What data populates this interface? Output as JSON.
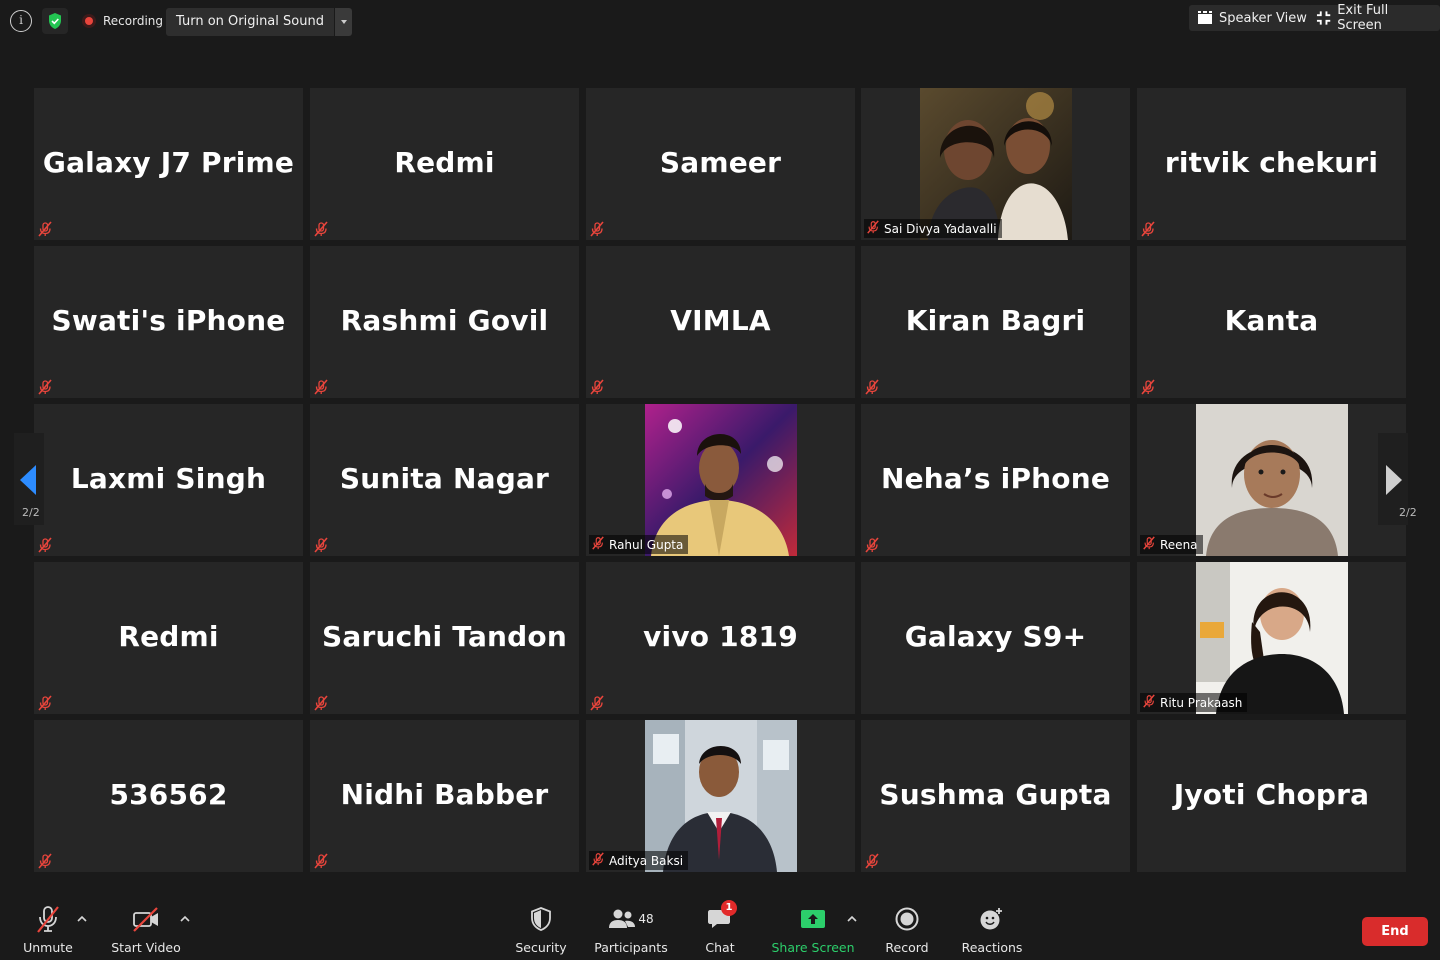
{
  "topbar": {
    "recording_label": "Recording",
    "original_sound_label": "Turn on Original Sound",
    "speaker_view_label": "Speaker View",
    "exit_full_screen_label": "Exit Full Screen"
  },
  "pagination": {
    "left_label": "2/2",
    "right_label": "2/2"
  },
  "participants": [
    {
      "name": "Galaxy J7 Prime",
      "muted": true
    },
    {
      "name": "Redmi",
      "muted": true
    },
    {
      "name": "Sameer",
      "muted": true
    },
    {
      "name": "Sai Divya Yadavalli",
      "muted": true,
      "video": true
    },
    {
      "name": "ritvik chekuri",
      "muted": true
    },
    {
      "name": "Swati's iPhone",
      "muted": true
    },
    {
      "name": "Rashmi Govil",
      "muted": true
    },
    {
      "name": "VIMLA",
      "muted": true
    },
    {
      "name": "Kiran Bagri",
      "muted": true
    },
    {
      "name": "Kanta",
      "muted": true
    },
    {
      "name": "Laxmi Singh",
      "muted": true
    },
    {
      "name": "Sunita Nagar",
      "muted": true
    },
    {
      "name": "Rahul Gupta",
      "muted": true,
      "video": true
    },
    {
      "name": "Neha’s iPhone",
      "muted": true
    },
    {
      "name": "Reena",
      "muted": true,
      "video": true
    },
    {
      "name": "Redmi",
      "muted": true
    },
    {
      "name": "Saruchi Tandon",
      "muted": true
    },
    {
      "name": "vivo 1819",
      "muted": true
    },
    {
      "name": "Galaxy S9+",
      "muted": false
    },
    {
      "name": "Ritu Prakaash",
      "muted": true,
      "video": true
    },
    {
      "name": "536562",
      "muted": true
    },
    {
      "name": "Nidhi Babber",
      "muted": true
    },
    {
      "name": "Aditya Baksi",
      "muted": true,
      "video": true
    },
    {
      "name": "Sushma Gupta",
      "muted": true
    },
    {
      "name": "Jyoti Chopra",
      "muted": false
    }
  ],
  "toolbar": {
    "unmute_label": "Unmute",
    "start_video_label": "Start Video",
    "security_label": "Security",
    "participants_label": "Participants",
    "participants_count": "48",
    "chat_label": "Chat",
    "chat_badge": "1",
    "share_screen_label": "Share Screen",
    "record_label": "Record",
    "reactions_label": "Reactions",
    "end_label": "End"
  },
  "colors": {
    "share_green": "#2ccf6b",
    "end_red": "#d92c2c",
    "mute_red": "#e8453c",
    "shield_green": "#23c552"
  }
}
